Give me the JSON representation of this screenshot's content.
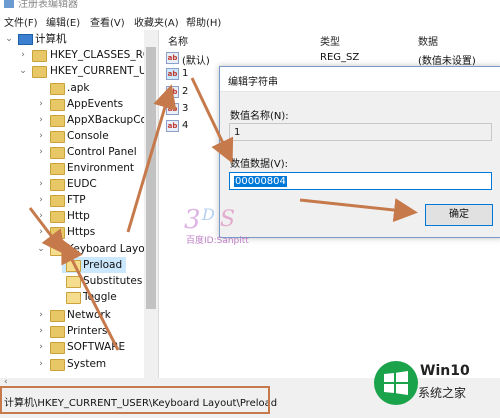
{
  "window": {
    "title": "注册表编辑器"
  },
  "menu": [
    "文件(F)",
    "编辑(E)",
    "查看(V)",
    "收藏夹(A)",
    "帮助(H)"
  ],
  "tree": {
    "root": "计算机",
    "classes_root": "HKEY_CLASSES_ROO",
    "current_user": "HKEY_CURRENT_US",
    "items": [
      ".apk",
      "AppEvents",
      "AppXBackupCor",
      "Console",
      "Control Panel",
      "Environment",
      "EUDC",
      "FTP",
      "Http",
      "Https"
    ],
    "keyboard_layout": "Keyboard Layout",
    "keyboard_children": [
      "Preload",
      "Substitutes",
      "Toggle"
    ],
    "after": [
      "Network",
      "Printers",
      "SOFTWARE",
      "System"
    ]
  },
  "list": {
    "headers": {
      "name": "名称",
      "type": "类型",
      "data": "数据"
    },
    "rows": [
      {
        "name": "(默认)",
        "type": "REG_SZ",
        "data": "(数值未设置)"
      },
      {
        "name": "1"
      },
      {
        "name": "2"
      },
      {
        "name": "3"
      },
      {
        "name": "4"
      }
    ]
  },
  "dialog": {
    "title": "编辑字符串",
    "name_label": "数值名称(N):",
    "name_value": "1",
    "data_label": "数值数据(V):",
    "data_value": "00000804",
    "ok_button": "确定"
  },
  "status": {
    "path": "计算机\\HKEY_CURRENT_USER\\Keyboard Layout\\Preload"
  },
  "watermark": {
    "text": "百度ID:Sanpitt"
  },
  "brand": {
    "logo_text": "Win10",
    "logo_sub": "系统之家"
  },
  "colors": {
    "accent": "#0078d7",
    "annotation": "#c6794a",
    "win_green": "#1aa34a"
  }
}
